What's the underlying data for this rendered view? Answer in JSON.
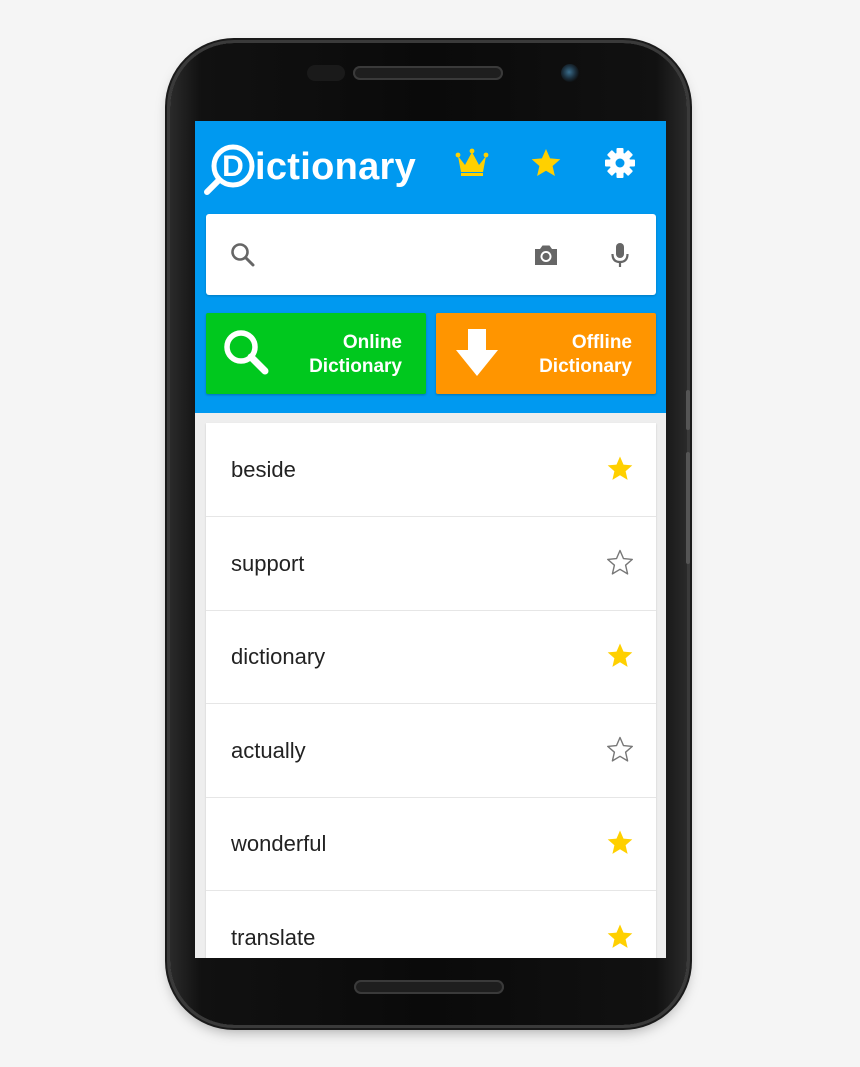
{
  "app": {
    "title": "Dictionary",
    "logo_letter": "D",
    "title_rest": "ictionary"
  },
  "header": {
    "premium_icon": "crown-icon",
    "favorites_icon": "star-icon",
    "settings_icon": "gear-icon"
  },
  "search": {
    "value": "",
    "placeholder": "",
    "icons": [
      "search-icon",
      "camera-icon",
      "microphone-icon"
    ]
  },
  "buttons": {
    "online": {
      "line1": "Online",
      "line2": "Dictionary",
      "color": "#00c81e",
      "icon": "search-icon"
    },
    "offline": {
      "line1": "Offline",
      "line2": "Dictionary",
      "color": "#ff9500",
      "icon": "download-arrow-icon"
    }
  },
  "colors": {
    "primary": "#0099f0",
    "star_active": "#ffd000",
    "star_inactive": "#777777"
  },
  "history": [
    {
      "word": "beside",
      "favorite": true
    },
    {
      "word": "support",
      "favorite": false
    },
    {
      "word": "dictionary",
      "favorite": true
    },
    {
      "word": "actually",
      "favorite": false
    },
    {
      "word": "wonderful",
      "favorite": true
    },
    {
      "word": "translate",
      "favorite": true
    }
  ]
}
